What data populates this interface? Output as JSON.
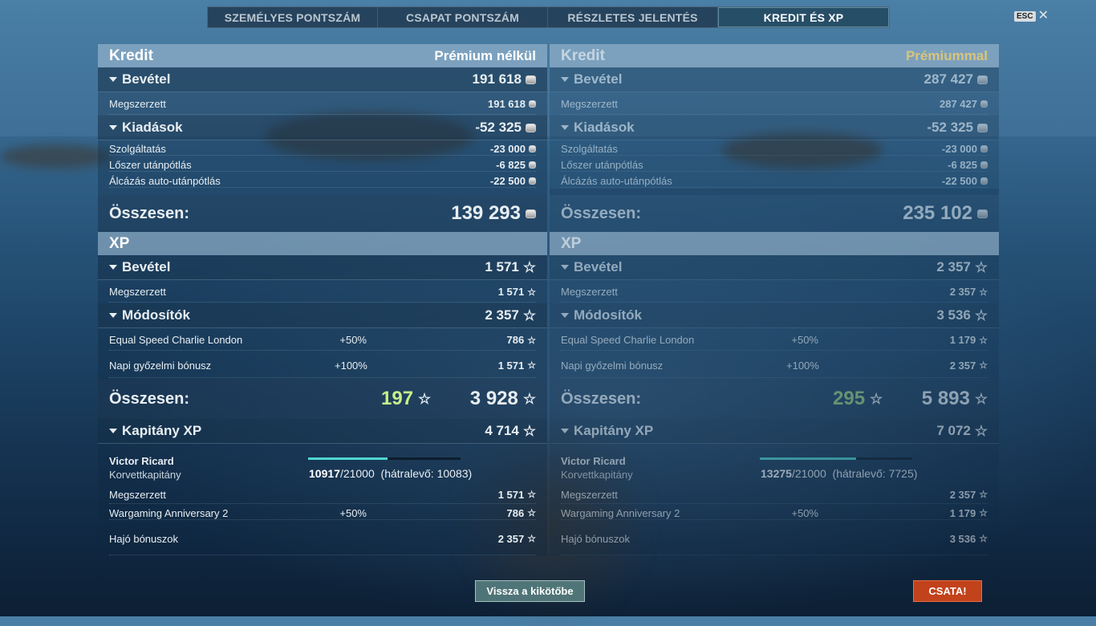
{
  "tabs": [
    "SZEMÉLYES PONTSZÁM",
    "CSAPAT PONTSZÁM",
    "RÉSZLETES JELENTÉS",
    "KREDIT ÉS XP"
  ],
  "active_tab": 3,
  "esc": {
    "key": "ESC",
    "close": "✕"
  },
  "left": {
    "credit_title": "Kredit",
    "credit_mode": "Prémium nélkül",
    "income_label": "Bevétel",
    "income_value": "191 618",
    "earned_label": "Megszerzett",
    "earned_value": "191 618",
    "expenses_label": "Kiadások",
    "expenses_value": "-52 325",
    "exp1_label": "Szolgáltatás",
    "exp1_value": "-23 000",
    "exp2_label": "Lőszer utánpótlás",
    "exp2_value": "-6 825",
    "exp3_label": "Álcázás auto-utánpótlás",
    "exp3_value": "-22 500",
    "credit_total_label": "Összesen:",
    "credit_total_value": "139 293",
    "xp_title": "XP",
    "xp_income_label": "Bevétel",
    "xp_income_value": "1 571",
    "xp_earned_label": "Megszerzett",
    "xp_earned_value": "1 571",
    "mod_label": "Módosítók",
    "mod_value": "2 357",
    "mod1_label": "Equal Speed Charlie London",
    "mod1_pct": "+50%",
    "mod1_value": "786",
    "mod2_label": "Napi győzelmi bónusz",
    "mod2_pct": "+100%",
    "mod2_value": "1 571",
    "xp_total_label": "Összesen:",
    "xp_free": "197",
    "xp_total_value": "3 928",
    "cap_label": "Kapitány XP",
    "cap_value": "4 714",
    "cap_name": "Victor Ricard",
    "cap_rank": "Korvettkapitány",
    "cap_current": "10917",
    "cap_max": "/21000",
    "cap_remaining": "(hátralevő: 10083)",
    "cap_progress": 0.52,
    "cap_earned_label": "Megszerzett",
    "cap_earned_value": "1 571",
    "cap_anniv_label": "Wargaming Anniversary 2",
    "cap_anniv_pct": "+50%",
    "cap_anniv_value": "786",
    "ship_bonus_label": "Hajó bónuszok",
    "ship_bonus_value": "2 357"
  },
  "right": {
    "credit_title": "Kredit",
    "credit_mode": "Prémiummal",
    "income_label": "Bevétel",
    "income_value": "287 427",
    "earned_label": "Megszerzett",
    "earned_value": "287 427",
    "expenses_label": "Kiadások",
    "expenses_value": "-52 325",
    "exp1_label": "Szolgáltatás",
    "exp1_value": "-23 000",
    "exp2_label": "Lőszer utánpótlás",
    "exp2_value": "-6 825",
    "exp3_label": "Álcázás auto-utánpótlás",
    "exp3_value": "-22 500",
    "credit_total_label": "Összesen:",
    "credit_total_value": "235 102",
    "xp_title": "XP",
    "xp_income_label": "Bevétel",
    "xp_income_value": "2 357",
    "xp_earned_label": "Megszerzett",
    "xp_earned_value": "2 357",
    "mod_label": "Módosítók",
    "mod_value": "3 536",
    "mod1_label": "Equal Speed Charlie London",
    "mod1_pct": "+50%",
    "mod1_value": "1 179",
    "mod2_label": "Napi győzelmi bónusz",
    "mod2_pct": "+100%",
    "mod2_value": "2 357",
    "xp_total_label": "Összesen:",
    "xp_free": "295",
    "xp_total_value": "5 893",
    "cap_label": "Kapitány XP",
    "cap_value": "7 072",
    "cap_name": "Victor Ricard",
    "cap_rank": "Korvettkapitány",
    "cap_current": "13275",
    "cap_max": "/21000",
    "cap_remaining": "(hátralevő: 7725)",
    "cap_progress": 0.63,
    "cap_earned_label": "Megszerzett",
    "cap_earned_value": "2 357",
    "cap_anniv_label": "Wargaming Anniversary 2",
    "cap_anniv_pct": "+50%",
    "cap_anniv_value": "1 179",
    "ship_bonus_label": "Hajó bónuszok",
    "ship_bonus_value": "3 536"
  },
  "buttons": {
    "back": "Vissza a kikötőbe",
    "battle": "CSATA!"
  }
}
